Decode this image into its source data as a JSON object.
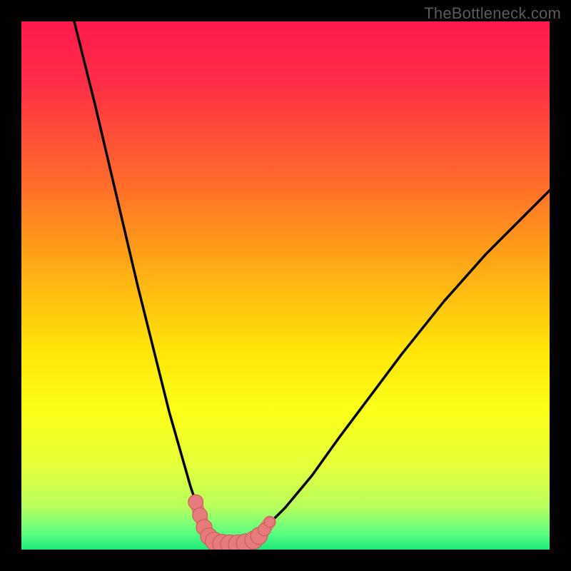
{
  "watermark": {
    "text": "TheBottleneck.com"
  },
  "colors": {
    "frame": "#000000",
    "gradient_stops": [
      {
        "offset": 0.0,
        "color": "#ff1a4d"
      },
      {
        "offset": 0.12,
        "color": "#ff2f46"
      },
      {
        "offset": 0.3,
        "color": "#ff6a2a"
      },
      {
        "offset": 0.48,
        "color": "#ffb014"
      },
      {
        "offset": 0.62,
        "color": "#ffe40a"
      },
      {
        "offset": 0.74,
        "color": "#fbff1a"
      },
      {
        "offset": 0.84,
        "color": "#e6ff3a"
      },
      {
        "offset": 0.92,
        "color": "#b6ff5e"
      },
      {
        "offset": 0.97,
        "color": "#5aff82"
      },
      {
        "offset": 1.0,
        "color": "#1ee876"
      }
    ],
    "curve": "#000000",
    "marker_fill": "#e77b7b",
    "marker_stroke": "#c85a5a"
  },
  "chart_data": {
    "type": "line",
    "title": "",
    "xlabel": "",
    "ylabel": "",
    "xlim": [
      0,
      100
    ],
    "ylim": [
      0,
      100
    ],
    "note": "Bottleneck-percentage style V-curve. y represents bottleneck % (0 at valley, ~100 at top). x is a normalized hardware balance axis.",
    "series": [
      {
        "name": "left-branch",
        "x": [
          10,
          14,
          18,
          22,
          26,
          28,
          30,
          32,
          33,
          34,
          35,
          36
        ],
        "y": [
          100,
          84,
          67,
          50,
          34,
          26,
          19,
          12,
          9,
          6,
          4,
          2
        ]
      },
      {
        "name": "valley",
        "x": [
          36,
          38,
          40,
          42,
          44
        ],
        "y": [
          2,
          1,
          1,
          1,
          2
        ]
      },
      {
        "name": "right-branch",
        "x": [
          44,
          46,
          50,
          55,
          60,
          66,
          72,
          80,
          88,
          96,
          100
        ],
        "y": [
          2,
          4,
          8,
          14,
          21,
          29,
          37,
          47,
          56,
          64,
          68
        ]
      }
    ],
    "markers": {
      "name": "highlighted-points",
      "comment": "Pink sausage-like markers clustered around the valley floor and lower slopes.",
      "points": [
        {
          "x": 33.0,
          "y": 9.0,
          "r": 1.4
        },
        {
          "x": 33.8,
          "y": 6.5,
          "r": 1.4
        },
        {
          "x": 34.6,
          "y": 4.2,
          "r": 1.5
        },
        {
          "x": 35.5,
          "y": 2.5,
          "r": 1.6
        },
        {
          "x": 36.5,
          "y": 1.6,
          "r": 1.7
        },
        {
          "x": 38.0,
          "y": 1.1,
          "r": 1.8
        },
        {
          "x": 39.5,
          "y": 1.0,
          "r": 1.8
        },
        {
          "x": 41.0,
          "y": 1.0,
          "r": 1.8
        },
        {
          "x": 42.5,
          "y": 1.2,
          "r": 1.8
        },
        {
          "x": 44.0,
          "y": 1.8,
          "r": 1.7
        },
        {
          "x": 45.0,
          "y": 2.6,
          "r": 1.6
        },
        {
          "x": 46.0,
          "y": 3.8,
          "r": 1.2
        },
        {
          "x": 47.0,
          "y": 5.2,
          "r": 1.0
        }
      ]
    }
  }
}
